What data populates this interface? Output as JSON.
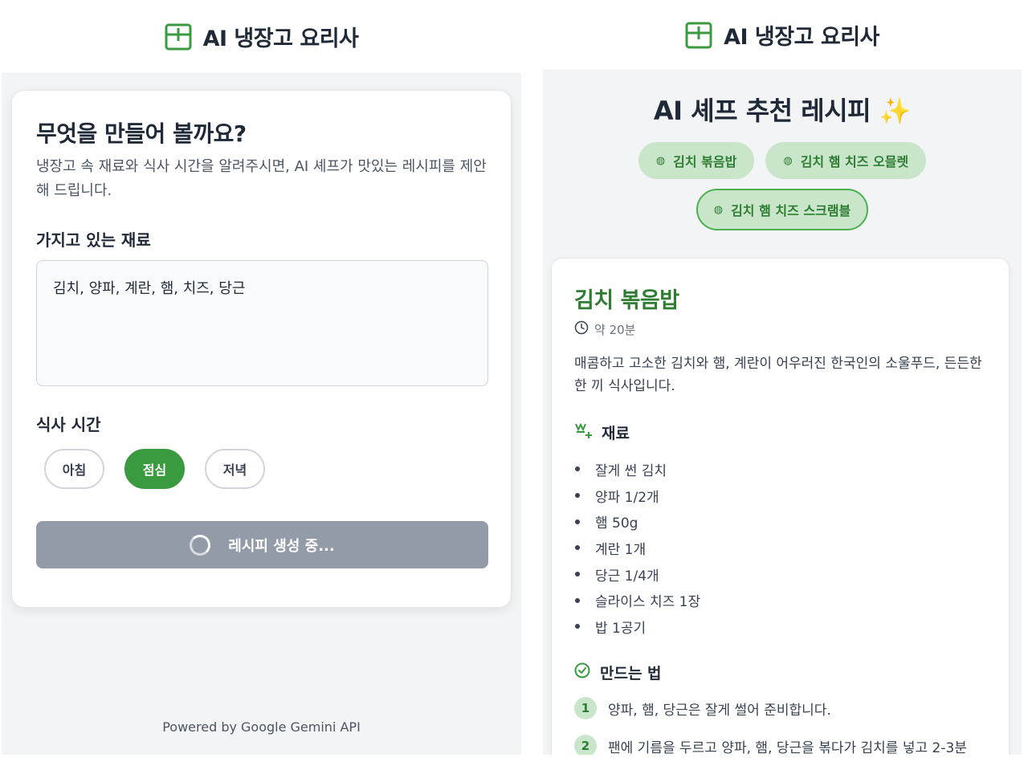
{
  "app": {
    "title": "AI 냉장고 요리사",
    "brand_color": "#3a9a40"
  },
  "form": {
    "heading": "무엇을 만들어 볼까요?",
    "description": "냉장고 속 재료와 식사 시간을 알려주시면, AI 셰프가 맛있는 레시피를 제안해 드립니다.",
    "ingredients_label": "가지고 있는 재료",
    "ingredients_value": "김치, 양파, 계란, 햄, 치즈, 당근",
    "meal_time_label": "식사 시간",
    "meal_options": [
      "아침",
      "점심",
      "저녁"
    ],
    "selected_meal": "점심",
    "generate_button": "레시피 생성 중...",
    "loading": true
  },
  "footer": "Powered by Google Gemini API",
  "result": {
    "title": "AI 셰프 추천 레시피 ✨",
    "recipe_tabs": [
      "김치 볶음밥",
      "김치 햄 치즈 오믈렛",
      "김치 햄 치즈 스크램블"
    ],
    "selected_tab": "김치 햄 치즈 스크램블",
    "recipe": {
      "name": "김치 볶음밥",
      "time": "약 20분",
      "description": "매콤하고 고소한 김치와 햄, 계란이 어우러진 한국인의 소울푸드, 든든한 한 끼 식사입니다.",
      "ingredients_heading": "재료",
      "ingredients": [
        "잘게 썬 김치",
        "양파 1/2개",
        "햄 50g",
        "계란 1개",
        "당근 1/4개",
        "슬라이스 치즈 1장",
        "밥 1공기"
      ],
      "steps_heading": "만드는 법",
      "steps": [
        {
          "num": "1",
          "text": "양파, 햄, 당근은 잘게 썰어 준비합니다."
        },
        {
          "num": "2",
          "text": "팬에 기름을 두르고 양파, 햄, 당근을 볶다가 김치를 넣고 2-3분"
        }
      ]
    }
  }
}
